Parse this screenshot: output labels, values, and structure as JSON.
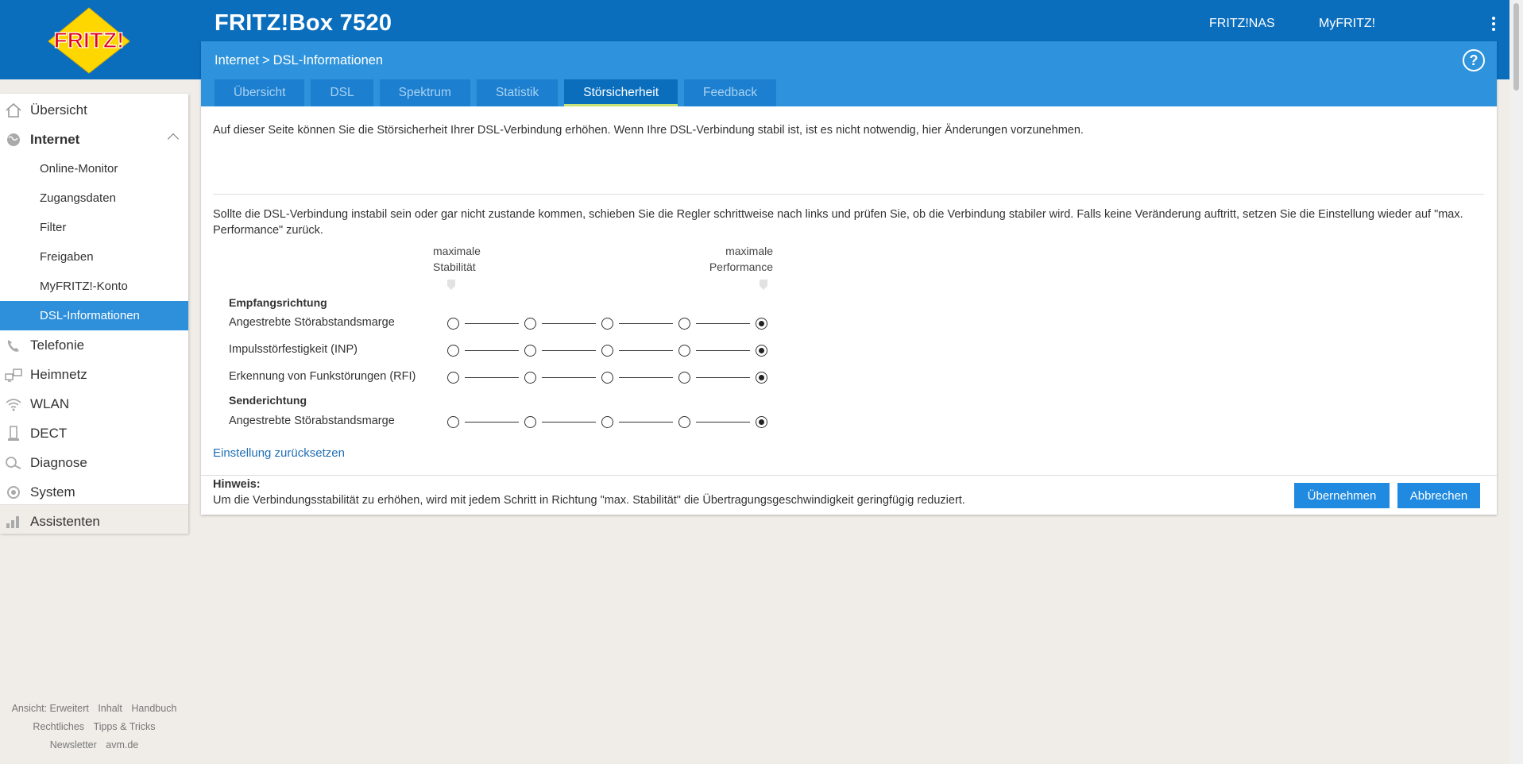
{
  "header": {
    "logo_text": "FRITZ!",
    "product": "FRITZ!Box 7520",
    "links": [
      "FRITZ!NAS",
      "MyFRITZ!"
    ]
  },
  "breadcrumb": {
    "parent": "Internet",
    "separator": ">",
    "current": "DSL-Informationen"
  },
  "tabs": [
    "Übersicht",
    "DSL",
    "Spektrum",
    "Statistik",
    "Störsicherheit",
    "Feedback"
  ],
  "active_tab": "Störsicherheit",
  "content": {
    "intro": "Auf dieser Seite können Sie die Störsicherheit Ihrer DSL-Verbindung erhöhen. Wenn Ihre DSL-Verbindung stabil ist, ist es nicht notwendig, hier Änderungen vorzunehmen.",
    "paragraph": "Sollte die DSL-Verbindung instabil sein oder gar nicht zustande kommen, schieben Sie die Regler schrittweise nach links und prüfen Sie, ob die Verbindung stabiler wird. Falls keine Veränderung auftritt, setzen Sie die Einstellung wieder auf \"max. Performance\" zurück.",
    "col_left_1": "maximale",
    "col_left_2": "Stabilität",
    "col_right_1": "maximale",
    "col_right_2": "Performance",
    "section_receive": "Empfangsrichtung",
    "section_send": "Senderichtung",
    "rows": [
      {
        "label": "Angestrebte Störabstandsmarge",
        "positions": 5,
        "selected": 5
      },
      {
        "label": "Impulsstörfestigkeit (INP)",
        "positions": 5,
        "selected": 5
      },
      {
        "label": "Erkennung von Funkstörungen (RFI)",
        "positions": 5,
        "selected": 5
      },
      {
        "label": "Angestrebte Störabstandsmarge",
        "positions": 5,
        "selected": 5
      }
    ],
    "reset_link": "Einstellung zurücksetzen",
    "hint_title": "Hinweis:",
    "hint_text": "Um die Verbindungsstabilität zu erhöhen, wird mit jedem Schritt in Richtung \"max. Stabilität\" die Übertragungsgeschwindigkeit geringfügig reduziert.",
    "btn_apply": "Übernehmen",
    "btn_cancel": "Abbrechen"
  },
  "sidebar": {
    "items": [
      {
        "label": "Übersicht",
        "icon": "home-icon"
      },
      {
        "label": "Internet",
        "icon": "globe-icon",
        "expanded": true
      },
      {
        "label": "Telefonie",
        "icon": "phone-icon"
      },
      {
        "label": "Heimnetz",
        "icon": "network-icon"
      },
      {
        "label": "WLAN",
        "icon": "wifi-icon"
      },
      {
        "label": "DECT",
        "icon": "dect-icon"
      },
      {
        "label": "Diagnose",
        "icon": "diagnose-icon"
      },
      {
        "label": "System",
        "icon": "system-icon"
      },
      {
        "label": "Assistenten",
        "icon": "wizard-icon"
      }
    ],
    "subitems": [
      "Online-Monitor",
      "Zugangsdaten",
      "Filter",
      "Freigaben",
      "MyFRITZ!-Konto",
      "DSL-Informationen"
    ],
    "active_subitem": "DSL-Informationen"
  },
  "footer_links": {
    "row1": [
      "Ansicht: Erweitert",
      "Inhalt",
      "Handbuch"
    ],
    "row2": [
      "Rechtliches",
      "Tipps & Tricks"
    ],
    "row3": [
      "Newsletter",
      "avm.de"
    ]
  },
  "colors": {
    "header_blue": "#0a6ebd",
    "panel_blue": "#2e93dc",
    "active_nav": "#2e8fdb",
    "tab_indicator": "#c6e17a",
    "logo_red": "#e2001a",
    "logo_yellow": "#ffd700"
  }
}
